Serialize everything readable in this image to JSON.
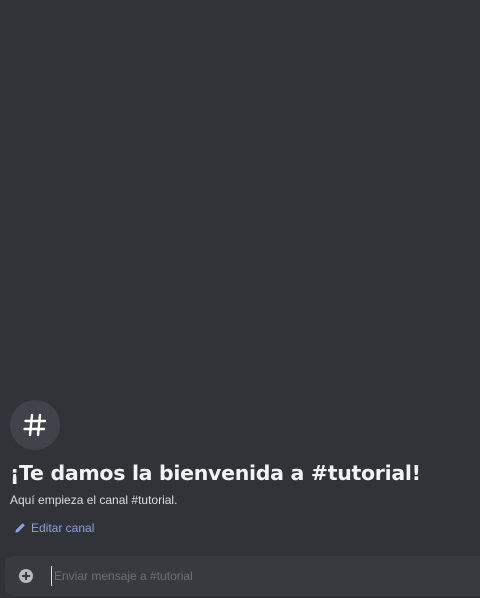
{
  "channel": {
    "welcome_title": "¡Te damos la bienvenida a #tutorial!",
    "welcome_subtitle": "Aquí empieza el canal #tutorial.",
    "edit_label": "Editar canal",
    "icon": "hash-icon"
  },
  "composer": {
    "placeholder": "Enviar mensaje a #tutorial",
    "value": "",
    "add_icon": "plus-circle-icon"
  },
  "colors": {
    "background": "#313338",
    "composer_background": "#383a40",
    "link": "#8ea1e1",
    "title": "#f2f3f5"
  }
}
